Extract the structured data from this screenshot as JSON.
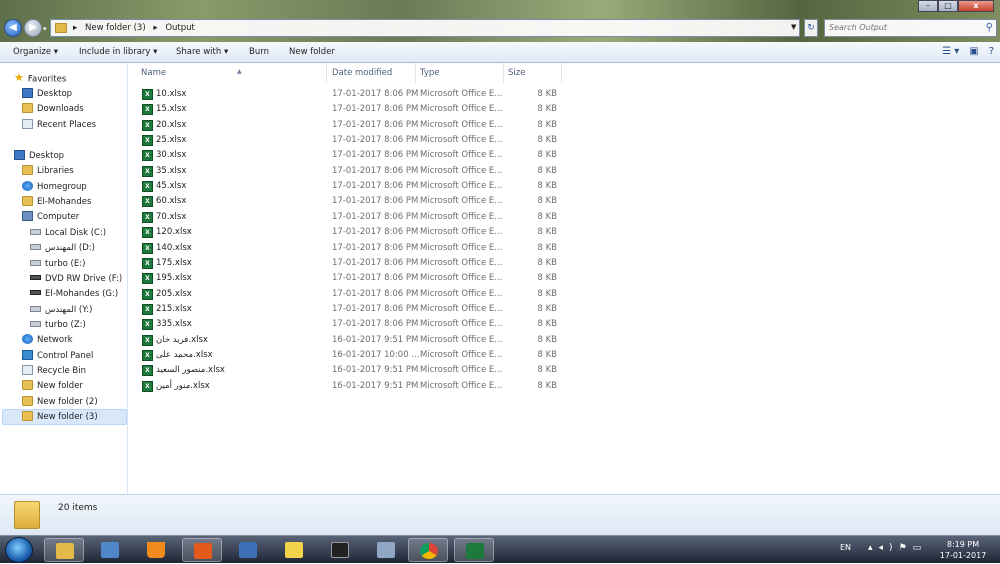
{
  "window": {
    "breadcrumb": [
      "New folder (3)",
      "Output"
    ],
    "search_placeholder": "Search Output",
    "controls": {
      "minimize": "–",
      "maximize": "□",
      "close": "x"
    }
  },
  "toolbar": {
    "organize": "Organize",
    "include_in_library": "Include in library",
    "share_with": "Share with",
    "burn": "Burn",
    "new_folder": "New folder"
  },
  "nav": {
    "favorites": "Favorites",
    "desktop_fav": "Desktop",
    "downloads": "Downloads",
    "recent_places": "Recent Places",
    "desktop": "Desktop",
    "libraries": "Libraries",
    "homegroup": "Homegroup",
    "el_mohandes": "El-Mohandes",
    "computer": "Computer",
    "local_disk": "Local Disk (C:)",
    "drive_d": "المهندس (D:)",
    "turbo_e": "turbo (E:)",
    "dvd": "DVD RW Drive (F:)",
    "drive_g": "El-Mohandes (G:)",
    "drive_y": "المهندس (Y:)",
    "turbo_z": "turbo (Z:)",
    "network": "Network",
    "control_panel": "Control Panel",
    "recycle_bin": "Recycle Bin",
    "new_folder": "New folder",
    "new_folder_2": "New folder (2)",
    "new_folder_3": "New folder (3)"
  },
  "columns": {
    "name": "Name",
    "date": "Date modified",
    "type": "Type",
    "size": "Size"
  },
  "files": [
    {
      "name": "10.xlsx",
      "date": "17-01-2017 8:06 PM",
      "type": "Microsoft Office E...",
      "size": "8 KB"
    },
    {
      "name": "15.xlsx",
      "date": "17-01-2017 8:06 PM",
      "type": "Microsoft Office E...",
      "size": "8 KB"
    },
    {
      "name": "20.xlsx",
      "date": "17-01-2017 8:06 PM",
      "type": "Microsoft Office E...",
      "size": "8 KB"
    },
    {
      "name": "25.xlsx",
      "date": "17-01-2017 8:06 PM",
      "type": "Microsoft Office E...",
      "size": "8 KB"
    },
    {
      "name": "30.xlsx",
      "date": "17-01-2017 8:06 PM",
      "type": "Microsoft Office E...",
      "size": "8 KB"
    },
    {
      "name": "35.xlsx",
      "date": "17-01-2017 8:06 PM",
      "type": "Microsoft Office E...",
      "size": "8 KB"
    },
    {
      "name": "45.xlsx",
      "date": "17-01-2017 8:06 PM",
      "type": "Microsoft Office E...",
      "size": "8 KB"
    },
    {
      "name": "60.xlsx",
      "date": "17-01-2017 8:06 PM",
      "type": "Microsoft Office E...",
      "size": "8 KB"
    },
    {
      "name": "70.xlsx",
      "date": "17-01-2017 8:06 PM",
      "type": "Microsoft Office E...",
      "size": "8 KB"
    },
    {
      "name": "120.xlsx",
      "date": "17-01-2017 8:06 PM",
      "type": "Microsoft Office E...",
      "size": "8 KB"
    },
    {
      "name": "140.xlsx",
      "date": "17-01-2017 8:06 PM",
      "type": "Microsoft Office E...",
      "size": "8 KB"
    },
    {
      "name": "175.xlsx",
      "date": "17-01-2017 8:06 PM",
      "type": "Microsoft Office E...",
      "size": "8 KB"
    },
    {
      "name": "195.xlsx",
      "date": "17-01-2017 8:06 PM",
      "type": "Microsoft Office E...",
      "size": "8 KB"
    },
    {
      "name": "205.xlsx",
      "date": "17-01-2017 8:06 PM",
      "type": "Microsoft Office E...",
      "size": "8 KB"
    },
    {
      "name": "215.xlsx",
      "date": "17-01-2017 8:06 PM",
      "type": "Microsoft Office E...",
      "size": "8 KB"
    },
    {
      "name": "335.xlsx",
      "date": "17-01-2017 8:06 PM",
      "type": "Microsoft Office E...",
      "size": "8 KB"
    },
    {
      "name": "فريد خان.xlsx",
      "date": "16-01-2017 9:51 PM",
      "type": "Microsoft Office E...",
      "size": "8 KB"
    },
    {
      "name": "محمد على.xlsx",
      "date": "16-01-2017 10:00 ...",
      "type": "Microsoft Office E...",
      "size": "8 KB"
    },
    {
      "name": "منصور السعيد.xlsx",
      "date": "16-01-2017 9:51 PM",
      "type": "Microsoft Office E...",
      "size": "8 KB"
    },
    {
      "name": "منور أمين.xlsx",
      "date": "16-01-2017 9:51 PM",
      "type": "Microsoft Office E...",
      "size": "8 KB"
    }
  ],
  "details": {
    "item_count": "20 items"
  },
  "taskbar": {
    "language": "EN",
    "time": "8:19 PM",
    "date": "17-01-2017"
  },
  "colors": {
    "selection": "#d9e8f9",
    "toolbar": "#dfe9f5",
    "excel": "#1e7a3c"
  }
}
